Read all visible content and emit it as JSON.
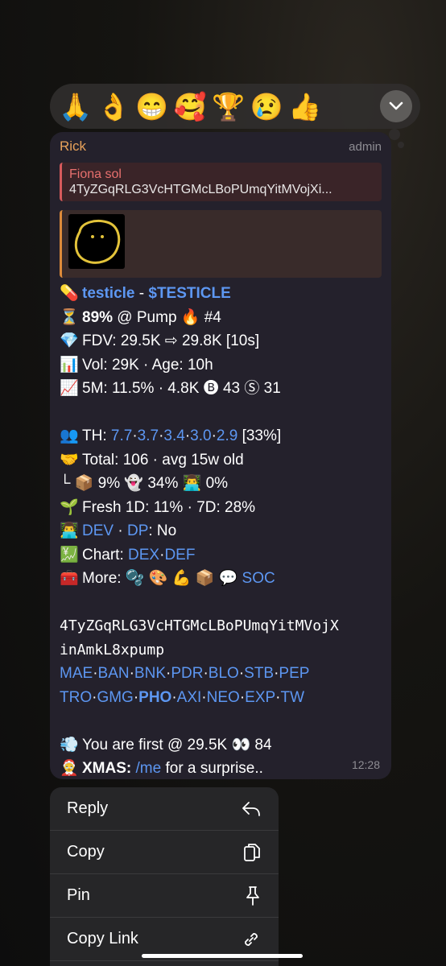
{
  "reactions": [
    "🙏",
    "👌",
    "😁",
    "🥰",
    "🏆",
    "😢",
    "👍"
  ],
  "message": {
    "sender": "Rick",
    "role": "admin",
    "reply": {
      "name": "Fiona sol",
      "text": "4TyZGqRLG3VcHTGMcLBoPUmqYitMVojXi..."
    },
    "l1": {
      "emoji": "💊",
      "name": "testicle",
      "sep": " - ",
      "ticker": "$TESTICLE"
    },
    "l2": {
      "emoji": "⏳",
      "pct": "89%",
      "rest": " @ Pump 🔥 #4"
    },
    "l3": {
      "emoji": "💎",
      "text": "FDV: 29.5K ⇨ 29.8K [10s]"
    },
    "l4": {
      "emoji": "📊",
      "text": "Vol: 29K · Age: 10h"
    },
    "l5": {
      "emoji": "📈",
      "text": "5M: 11.5% · 4.8K 🅑 43 Ⓢ 31"
    },
    "th": {
      "emoji": "👥",
      "label": "TH: ",
      "v1": "7.7",
      "v2": "3.7",
      "v3": "3.4",
      "v4": "3.0",
      "v5": "2.9",
      "dot": "·",
      "tail": " [33%]"
    },
    "l7": {
      "emoji": "🤝",
      "text": "Total: 106 · avg 15w old"
    },
    "l8": {
      "text": " └ 📦 9% 👻 34% 👨‍💻 0%"
    },
    "l9": {
      "emoji": "🌱",
      "text": "Fresh 1D: 11% · 7D: 28%"
    },
    "l10": {
      "emoji": "👨‍💻",
      "dev": "DEV",
      "sep": " · ",
      "dp": "DP",
      "tail": ": No"
    },
    "l11": {
      "emoji": "💹",
      "label": "Chart: ",
      "dex": "DEX",
      "dot": "·",
      "def": "DEF"
    },
    "l12": {
      "emoji": "🧰",
      "label": "More: ",
      "icons": "🫧 🎨 💪 📦 💬 ",
      "soc": "SOC"
    },
    "ca1": "4TyZGqRLG3VcHTGMcLBoPUmqYitMVojX",
    "ca2": "inAmkL8xpump",
    "links1": [
      "MAE",
      "BAN",
      "BNK",
      "PDR",
      "BLO",
      "STB",
      "PEP"
    ],
    "links2": [
      "TRO",
      "GMG",
      "PHO",
      "AXI",
      "NEO",
      "EXP",
      "TW"
    ],
    "dot": "·",
    "l15": {
      "emoji": "💨",
      "text": "You are first @ 29.5K 👀 84"
    },
    "l16": {
      "emoji": "🤶",
      "label": "XMAS:",
      "link": "/me",
      "tail": " for a surprise.."
    },
    "time": "12:28"
  },
  "menu": [
    {
      "label": "Reply",
      "icon": "reply-icon"
    },
    {
      "label": "Copy",
      "icon": "copy-icon"
    },
    {
      "label": "Pin",
      "icon": "pin-icon"
    },
    {
      "label": "Copy Link",
      "icon": "link-icon"
    }
  ]
}
